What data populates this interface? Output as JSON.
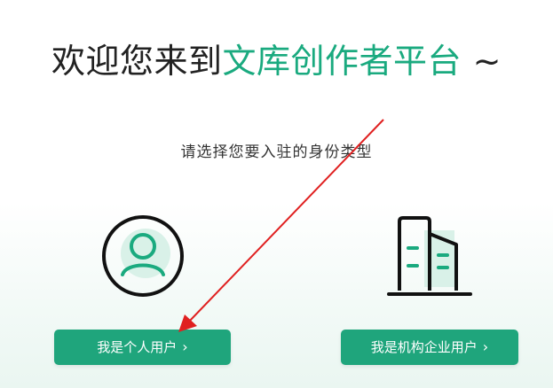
{
  "header": {
    "title_prefix": "欢迎您来到",
    "title_accent": "文库创作者平台",
    "title_suffix": "~"
  },
  "prompt": {
    "text": "请选择您要入驻的身份类型"
  },
  "options": {
    "personal": {
      "label": "我是个人用户",
      "chevron": "›",
      "icon": "person-icon"
    },
    "organization": {
      "label": "我是机构企业用户",
      "chevron": "›",
      "icon": "building-icon"
    }
  },
  "colors": {
    "accent": "#1aaa7f",
    "button": "#1fa57c",
    "annotation_arrow": "#e02020"
  }
}
